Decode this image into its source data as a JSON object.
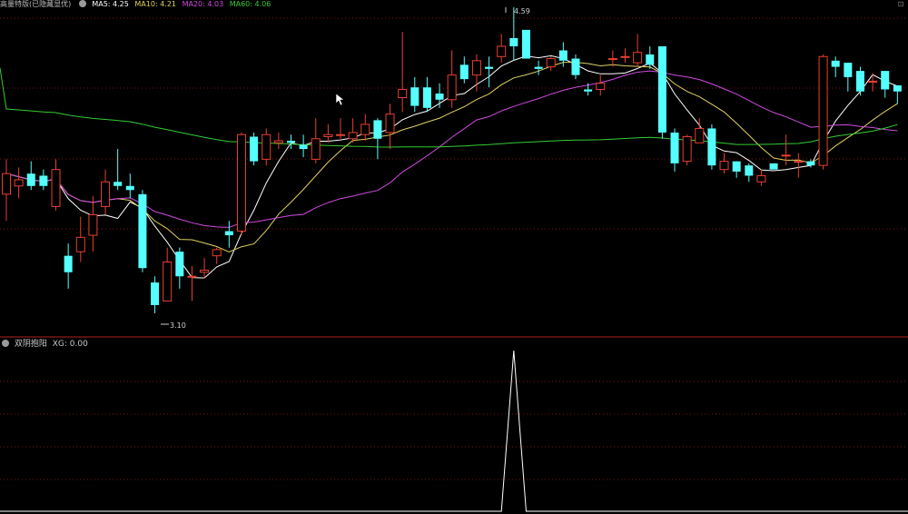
{
  "header": {
    "title": "高量特版(已隐藏显优)",
    "ma5": "MA5: 4.25",
    "ma10": "MA10: 4.21",
    "ma20": "MA20: 4.03",
    "ma60": "MA60: 4.06"
  },
  "indicator": {
    "name": "双阴抱阳",
    "value": "XG: 0.00"
  },
  "colors": {
    "up": "#e8412f",
    "down": "#54ffff",
    "ma5": "#ffffff",
    "ma10": "#e0d060",
    "ma20": "#d04ae0",
    "ma60": "#33cc33",
    "grid": "#7a1414",
    "signal": "#ffffff"
  },
  "chart_data": {
    "type": "candlestick",
    "annotations": {
      "high_label": "4.59",
      "low_label": "3.10"
    },
    "candles": [
      [
        3.68,
        3.85,
        3.78,
        3.55
      ],
      [
        3.72,
        3.81,
        3.75,
        3.66
      ],
      [
        3.78,
        3.84,
        3.72,
        3.7
      ],
      [
        3.77,
        3.8,
        3.72,
        3.7
      ],
      [
        3.62,
        3.85,
        3.8,
        3.6
      ],
      [
        3.38,
        3.44,
        3.3,
        3.22
      ],
      [
        3.4,
        3.57,
        3.47,
        3.35
      ],
      [
        3.48,
        3.67,
        3.58,
        3.4
      ],
      [
        3.62,
        3.8,
        3.74,
        3.58
      ],
      [
        3.74,
        3.9,
        3.72,
        3.7
      ],
      [
        3.72,
        3.78,
        3.7,
        3.66
      ],
      [
        3.68,
        3.7,
        3.32,
        3.3
      ],
      [
        3.25,
        3.28,
        3.14,
        3.1
      ],
      [
        3.16,
        3.42,
        3.35,
        3.16
      ],
      [
        3.4,
        3.42,
        3.28,
        3.22
      ],
      [
        3.28,
        3.33,
        3.28,
        3.16
      ],
      [
        3.3,
        3.37,
        3.31,
        3.27
      ],
      [
        3.38,
        3.42,
        3.41,
        3.34
      ],
      [
        3.5,
        3.55,
        3.48,
        3.42
      ],
      [
        3.5,
        3.98,
        3.97,
        3.48
      ],
      [
        3.96,
        3.98,
        3.84,
        3.82
      ],
      [
        3.85,
        4.0,
        3.97,
        3.82
      ],
      [
        3.93,
        3.98,
        3.94,
        3.9
      ],
      [
        3.94,
        3.97,
        3.93,
        3.9
      ],
      [
        3.92,
        3.97,
        3.9,
        3.86
      ],
      [
        3.85,
        4.05,
        3.95,
        3.83
      ],
      [
        3.96,
        4.02,
        3.97,
        3.93
      ],
      [
        3.97,
        4.05,
        3.97,
        3.95
      ],
      [
        3.95,
        4.05,
        3.98,
        3.93
      ],
      [
        3.97,
        4.07,
        4.02,
        3.94
      ],
      [
        4.04,
        4.05,
        3.95,
        3.85
      ],
      [
        3.98,
        4.12,
        4.07,
        3.9
      ],
      [
        4.15,
        4.47,
        4.19,
        4.08
      ],
      [
        4.2,
        4.25,
        4.11,
        4.08
      ],
      [
        4.2,
        4.25,
        4.1,
        4.08
      ],
      [
        4.17,
        4.22,
        4.14,
        4.1
      ],
      [
        4.14,
        4.38,
        4.26,
        4.1
      ],
      [
        4.31,
        4.35,
        4.24,
        4.22
      ],
      [
        4.26,
        4.36,
        4.33,
        4.18
      ],
      [
        4.3,
        4.35,
        4.29,
        4.2
      ],
      [
        4.35,
        4.46,
        4.4,
        4.32
      ],
      [
        4.44,
        4.59,
        4.4,
        4.33
      ],
      [
        4.48,
        4.45,
        4.34,
        4.38
      ],
      [
        4.3,
        4.33,
        4.29,
        4.26
      ],
      [
        4.3,
        4.35,
        4.34,
        4.28
      ],
      [
        4.38,
        4.42,
        4.33,
        4.3
      ],
      [
        4.34,
        4.36,
        4.26,
        4.24
      ],
      [
        4.19,
        4.22,
        4.18,
        4.16
      ],
      [
        4.19,
        4.26,
        4.22,
        4.16
      ],
      [
        4.34,
        4.38,
        4.34,
        4.3
      ],
      [
        4.35,
        4.39,
        4.35,
        4.32
      ],
      [
        4.32,
        4.46,
        4.37,
        4.3
      ],
      [
        4.36,
        4.4,
        4.31,
        4.29
      ],
      [
        4.4,
        4.4,
        3.98,
        3.95
      ],
      [
        3.98,
        4.0,
        3.83,
        3.79
      ],
      [
        3.84,
        3.97,
        3.96,
        3.82
      ],
      [
        3.93,
        4.05,
        4.0,
        3.94
      ],
      [
        4.0,
        4.02,
        3.82,
        3.8
      ],
      [
        3.8,
        3.88,
        3.84,
        3.78
      ],
      [
        3.84,
        3.84,
        3.79,
        3.76
      ],
      [
        3.82,
        3.83,
        3.77,
        3.74
      ],
      [
        3.74,
        3.8,
        3.77,
        3.72
      ],
      [
        3.83,
        3.83,
        3.8,
        3.8
      ],
      [
        3.87,
        3.97,
        3.87,
        3.82
      ],
      [
        3.84,
        3.88,
        3.84,
        3.76
      ],
      [
        3.84,
        3.85,
        3.82,
        3.81
      ],
      [
        3.82,
        4.36,
        4.35,
        3.8
      ],
      [
        4.33,
        4.35,
        4.3,
        4.25
      ],
      [
        4.32,
        4.31,
        4.25,
        4.18
      ],
      [
        4.28,
        4.3,
        4.18,
        4.16
      ],
      [
        4.23,
        4.27,
        4.23,
        4.18
      ],
      [
        4.28,
        4.28,
        4.19,
        4.15
      ],
      [
        4.21,
        4.21,
        4.18,
        4.12
      ]
    ],
    "signal": {
      "peak_index": 41
    }
  }
}
